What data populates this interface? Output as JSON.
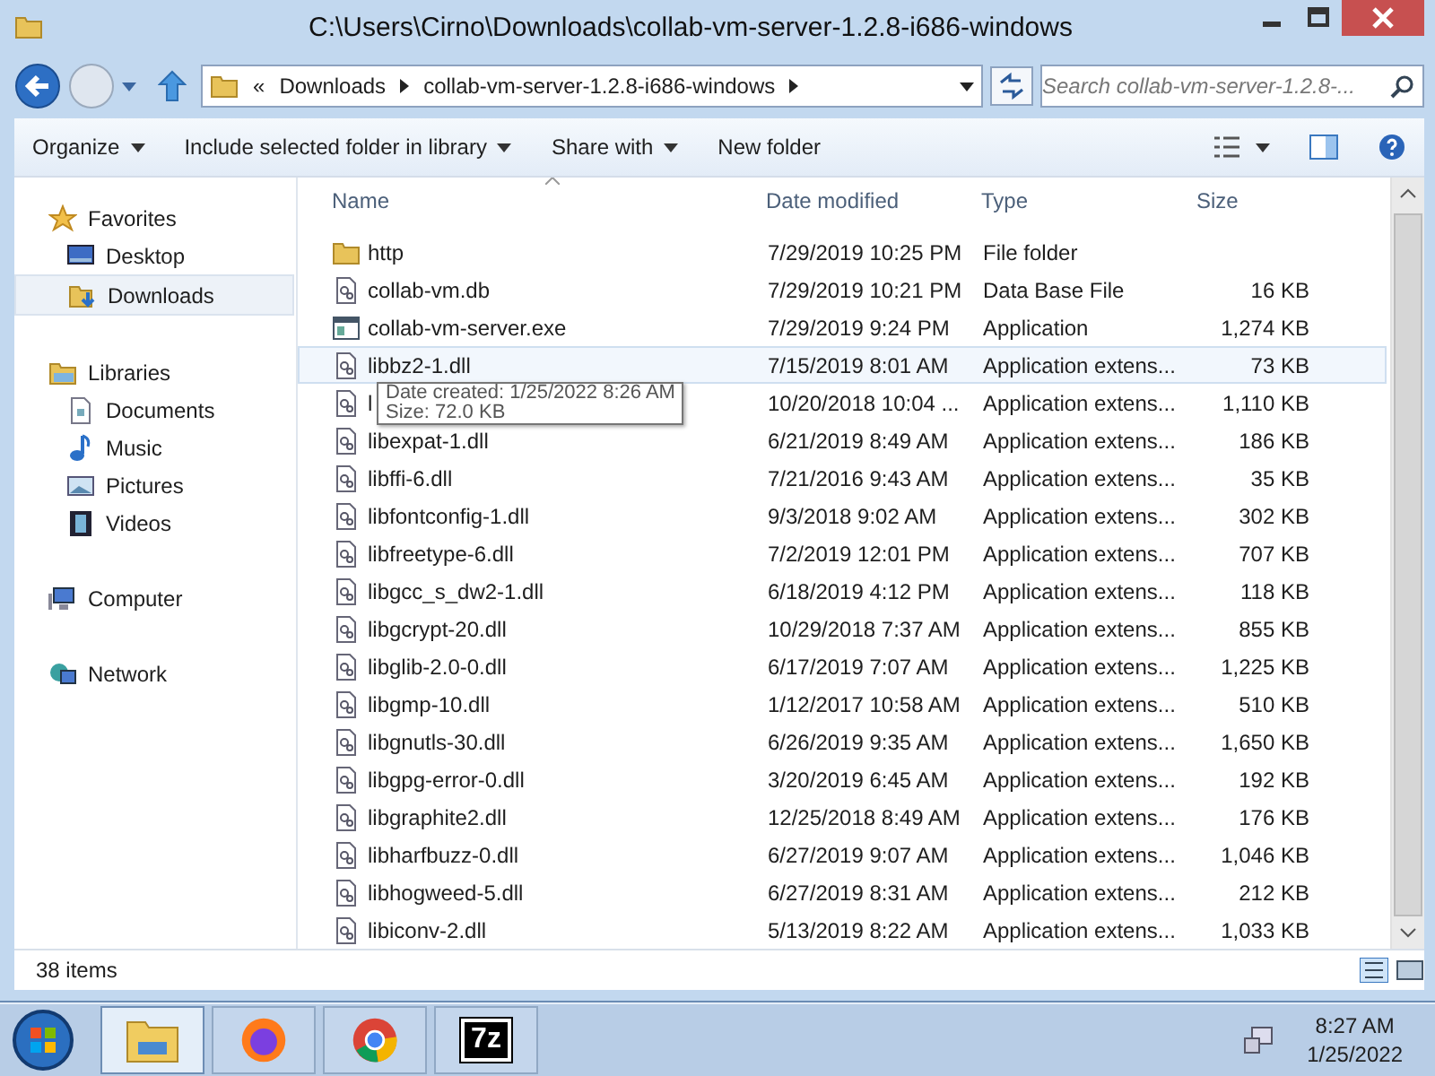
{
  "window": {
    "title": "C:\\Users\\Cirno\\Downloads\\collab-vm-server-1.2.8-i686-windows"
  },
  "address": {
    "overflow": "«",
    "crumbs": [
      "Downloads",
      "collab-vm-server-1.2.8-i686-windows"
    ]
  },
  "search": {
    "placeholder": "Search collab-vm-server-1.2.8-..."
  },
  "toolbar": [
    {
      "label": "Organize",
      "dropdown": true
    },
    {
      "label": "Include selected folder in library",
      "dropdown": true
    },
    {
      "label": "Share with",
      "dropdown": true
    },
    {
      "label": "New folder",
      "dropdown": false
    }
  ],
  "sidebar": {
    "groups": [
      {
        "label": "Favorites",
        "kind": "favorites",
        "children": [
          {
            "label": "Desktop",
            "kind": "desktop",
            "selected": false
          },
          {
            "label": "Downloads",
            "kind": "downloads",
            "selected": true
          }
        ]
      },
      {
        "label": "Libraries",
        "kind": "libraries",
        "children": [
          {
            "label": "Documents",
            "kind": "documents",
            "selected": false
          },
          {
            "label": "Music",
            "kind": "music",
            "selected": false
          },
          {
            "label": "Pictures",
            "kind": "pictures",
            "selected": false
          },
          {
            "label": "Videos",
            "kind": "videos",
            "selected": false
          }
        ]
      },
      {
        "label": "Computer",
        "kind": "computer"
      },
      {
        "label": "Network",
        "kind": "network"
      }
    ]
  },
  "table": {
    "columns": [
      "Name",
      "Date modified",
      "Type",
      "Size"
    ],
    "rows": [
      {
        "kind": "folder",
        "name": "http",
        "date": "7/29/2019 10:25 PM",
        "type": "File folder",
        "hovered": false
      },
      {
        "kind": "file",
        "name": "collab-vm.db",
        "date": "7/29/2019 10:21 PM",
        "type": "Data Base File",
        "size": "16 KB",
        "hovered": false
      },
      {
        "kind": "app",
        "name": "collab-vm-server.exe",
        "date": "7/29/2019 9:24 PM",
        "type": "Application",
        "size": "1,274 KB",
        "hovered": false
      },
      {
        "kind": "file",
        "name": "libbz2-1.dll",
        "date": "7/15/2019 8:01 AM",
        "type": "Application extens...",
        "size": "73 KB",
        "hovered": true
      },
      {
        "kind": "file",
        "name": "l",
        "date": "10/20/2018 10:04 ...",
        "type": "Application extens...",
        "size": "1,110 KB",
        "hovered": false
      },
      {
        "kind": "file",
        "name": "libexpat-1.dll",
        "date": "6/21/2019 8:49 AM",
        "type": "Application extens...",
        "size": "186 KB",
        "hovered": false
      },
      {
        "kind": "file",
        "name": "libffi-6.dll",
        "date": "7/21/2016 9:43 AM",
        "type": "Application extens...",
        "size": "35 KB",
        "hovered": false
      },
      {
        "kind": "file",
        "name": "libfontconfig-1.dll",
        "date": "9/3/2018 9:02 AM",
        "type": "Application extens...",
        "size": "302 KB",
        "hovered": false
      },
      {
        "kind": "file",
        "name": "libfreetype-6.dll",
        "date": "7/2/2019 12:01 PM",
        "type": "Application extens...",
        "size": "707 KB",
        "hovered": false
      },
      {
        "kind": "file",
        "name": "libgcc_s_dw2-1.dll",
        "date": "6/18/2019 4:12 PM",
        "type": "Application extens...",
        "size": "118 KB",
        "hovered": false
      },
      {
        "kind": "file",
        "name": "libgcrypt-20.dll",
        "date": "10/29/2018 7:37 AM",
        "type": "Application extens...",
        "size": "855 KB",
        "hovered": false
      },
      {
        "kind": "file",
        "name": "libglib-2.0-0.dll",
        "date": "6/17/2019 7:07 AM",
        "type": "Application extens...",
        "size": "1,225 KB",
        "hovered": false
      },
      {
        "kind": "file",
        "name": "libgmp-10.dll",
        "date": "1/12/2017 10:58 AM",
        "type": "Application extens...",
        "size": "510 KB",
        "hovered": false
      },
      {
        "kind": "file",
        "name": "libgnutls-30.dll",
        "date": "6/26/2019 9:35 AM",
        "type": "Application extens...",
        "size": "1,650 KB",
        "hovered": false
      },
      {
        "kind": "file",
        "name": "libgpg-error-0.dll",
        "date": "3/20/2019 6:45 AM",
        "type": "Application extens...",
        "size": "192 KB",
        "hovered": false
      },
      {
        "kind": "file",
        "name": "libgraphite2.dll",
        "date": "12/25/2018 8:49 AM",
        "type": "Application extens...",
        "size": "176 KB",
        "hovered": false
      },
      {
        "kind": "file",
        "name": "libharfbuzz-0.dll",
        "date": "6/27/2019 9:07 AM",
        "type": "Application extens...",
        "size": "1,046 KB",
        "hovered": false
      },
      {
        "kind": "file",
        "name": "libhogweed-5.dll",
        "date": "6/27/2019 8:31 AM",
        "type": "Application extens...",
        "size": "212 KB",
        "hovered": false
      },
      {
        "kind": "file",
        "name": "libiconv-2.dll",
        "date": "5/13/2019 8:22 AM",
        "type": "Application extens...",
        "size": "1,033 KB",
        "hovered": false
      }
    ]
  },
  "tooltip": {
    "lines": [
      "Date created: 1/25/2022 8:26 AM",
      "Size: 72.0 KB"
    ]
  },
  "status_bar": {
    "text": "38 items"
  },
  "taskbar": {
    "apps": [
      {
        "kind": "explorer",
        "selected": true
      },
      {
        "kind": "firefox",
        "selected": false
      },
      {
        "kind": "chrome",
        "selected": false
      },
      {
        "kind": "sevenzip",
        "label": "7z",
        "selected": false
      }
    ],
    "clock": {
      "time": "8:27 AM",
      "date": "1/25/2022"
    }
  }
}
